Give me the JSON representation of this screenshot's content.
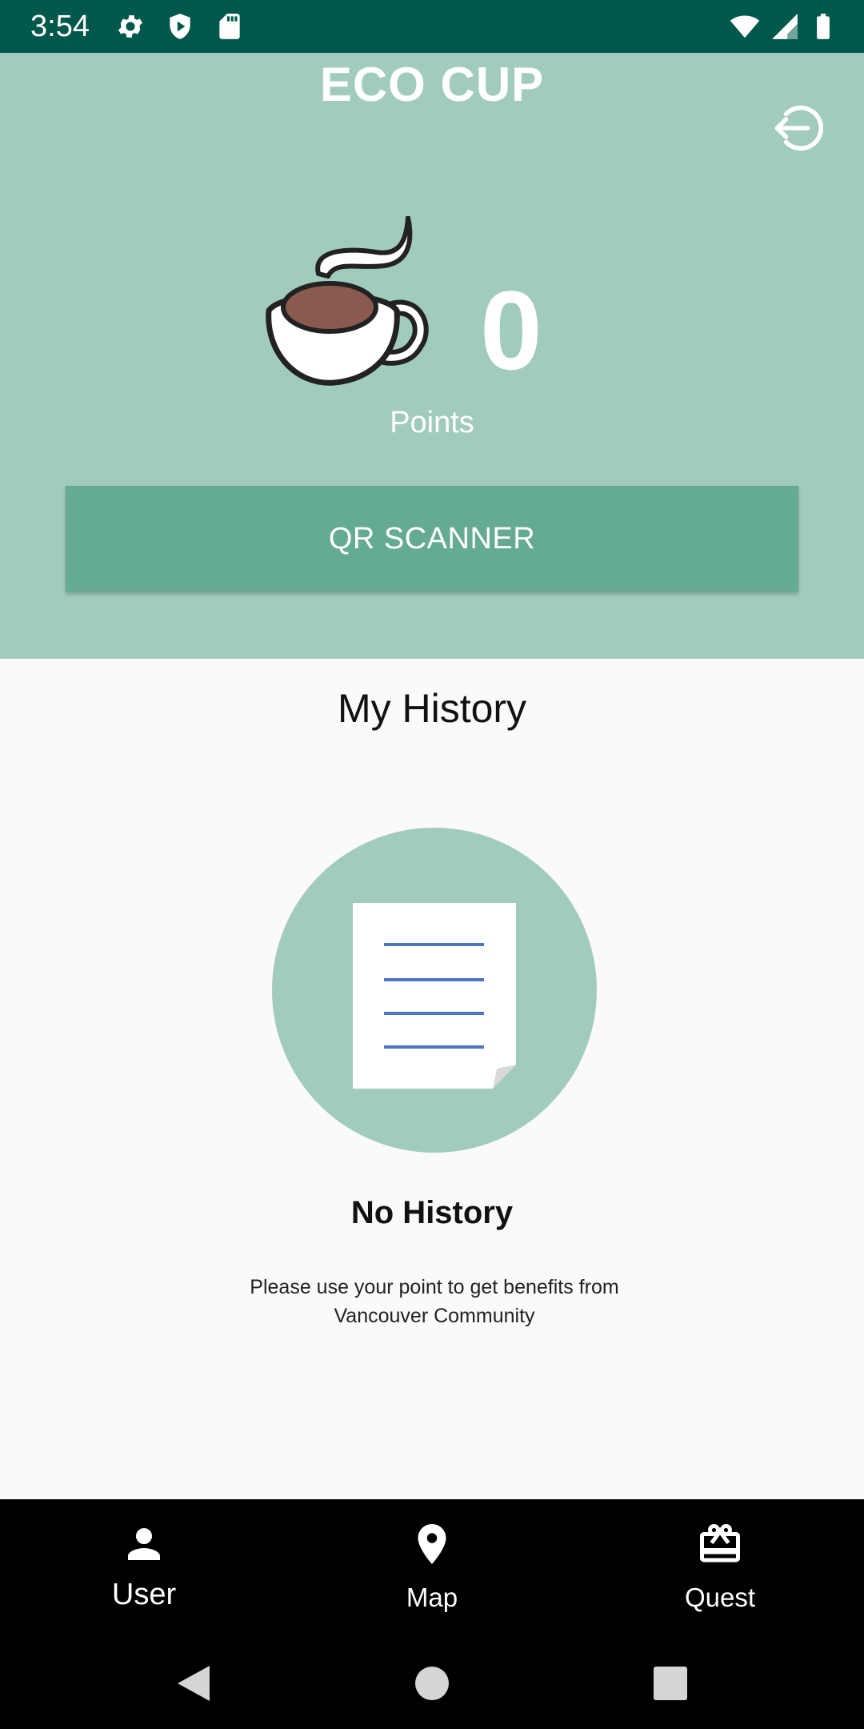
{
  "status_bar": {
    "time": "3:54",
    "icons": [
      "gear-icon",
      "shield-icon",
      "sd-card-icon",
      "wifi-icon",
      "signal-icon",
      "battery-icon"
    ]
  },
  "header": {
    "title": "ECO CUP",
    "logout_icon": "logout-icon",
    "points_value": "0",
    "points_label": "Points",
    "qr_button_label": "QR SCANNER"
  },
  "history": {
    "title": "My History",
    "empty_title": "No History",
    "empty_description": "Please use your point to get benefits from Vancouver Community"
  },
  "bottom_nav": {
    "items": [
      {
        "label": "User",
        "icon": "person-icon",
        "active": true
      },
      {
        "label": "Map",
        "icon": "location-pin-icon",
        "active": false
      },
      {
        "label": "Quest",
        "icon": "gift-card-icon",
        "active": false
      }
    ]
  },
  "colors": {
    "status_bar": "#00574b",
    "header": "#a2cbbf",
    "accent_button": "#64aa94",
    "nav_background": "#000000"
  }
}
